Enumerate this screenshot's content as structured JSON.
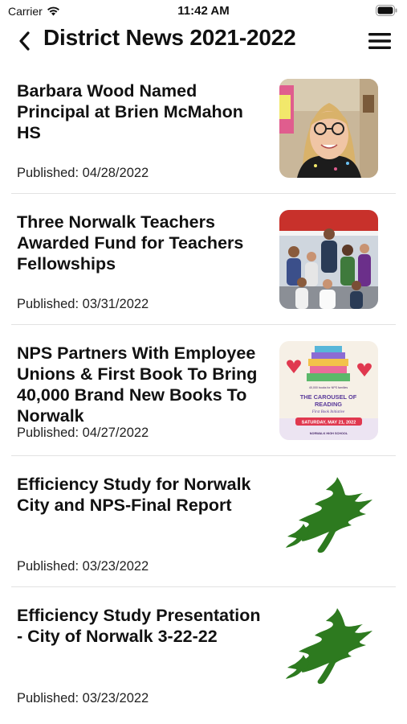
{
  "status_bar": {
    "carrier": "Carrier",
    "time": "11:42 AM"
  },
  "nav": {
    "title": "District News 2021-2022",
    "back_icon": "chevron-left-icon",
    "menu_icon": "hamburger-menu-icon"
  },
  "news": [
    {
      "title": "Barbara Wood Named Principal at Brien McMahon HS",
      "date": "Published: 04/28/2022",
      "thumbnail": "photo-portrait"
    },
    {
      "title": "Three Norwalk Teachers Awarded Fund for Teachers Fellowships",
      "date": "Published: 03/31/2022",
      "thumbnail": "photo-group"
    },
    {
      "title": "NPS Partners With Employee Unions & First Book To Bring 40,000 Brand New Books To Norwalk",
      "date": "Published: 04/27/2022",
      "thumbnail": "poster-carousel-of-reading"
    },
    {
      "title": "Efficiency Study for Norwalk City and NPS-Final Report",
      "date": "Published: 03/23/2022",
      "thumbnail": "norwalk-tree-logo"
    },
    {
      "title": "Efficiency Study Presentation - City of Norwalk 3-22-22",
      "date": "Published: 03/23/2022",
      "thumbnail": "norwalk-tree-logo"
    }
  ],
  "poster": {
    "heading": "THE CAROUSEL OF READING",
    "sub": "First Book Initiative",
    "date_banner": "SATURDAY, MAY 21, 2022",
    "footer": "NORWALK HIGH SCHOOL"
  },
  "colors": {
    "logo_green": "#2d7a1f",
    "text": "#111111",
    "divider": "#e2e2e2"
  }
}
